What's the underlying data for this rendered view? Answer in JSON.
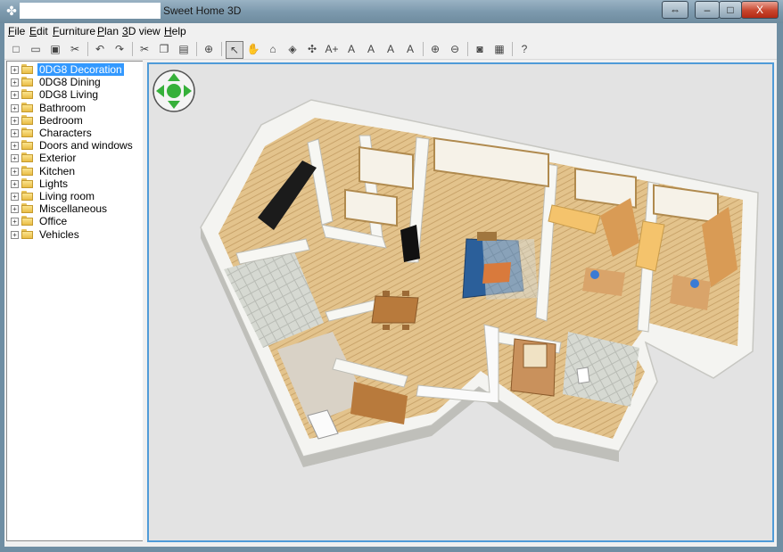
{
  "window": {
    "title": "Sweet Home 3D",
    "icon": "app-icon",
    "controls": {
      "swap": "⇔",
      "minimize": "–",
      "maximize": "□",
      "close": "X"
    }
  },
  "menu": [
    "File",
    "Edit",
    "Furniture",
    "Plan",
    "3D view",
    "Help"
  ],
  "toolbar": [
    {
      "name": "new-home-icon",
      "glyph": "□"
    },
    {
      "name": "open-icon",
      "glyph": "▭"
    },
    {
      "name": "save-icon",
      "glyph": "▣"
    },
    {
      "name": "preferences-icon",
      "glyph": "✂"
    },
    {
      "name": "undo-icon",
      "glyph": "↶"
    },
    {
      "name": "redo-icon",
      "glyph": "↷"
    },
    {
      "name": "cut-icon",
      "glyph": "✂"
    },
    {
      "name": "copy-icon",
      "glyph": "❐"
    },
    {
      "name": "paste-icon",
      "glyph": "▤"
    },
    {
      "name": "add-furniture-icon",
      "glyph": "⊕"
    },
    {
      "name": "select-mode-icon",
      "glyph": "↖",
      "selected": true
    },
    {
      "name": "pan-mode-icon",
      "glyph": "✋"
    },
    {
      "name": "create-walls-icon",
      "glyph": "⌂"
    },
    {
      "name": "create-rooms-icon",
      "glyph": "◈"
    },
    {
      "name": "create-dimensions-icon",
      "glyph": "✣"
    },
    {
      "name": "add-text-icon",
      "glyph": "A+"
    },
    {
      "name": "increase-text-size-icon",
      "glyph": "A"
    },
    {
      "name": "decrease-text-size-icon",
      "glyph": "A"
    },
    {
      "name": "bold-text-icon",
      "glyph": "A"
    },
    {
      "name": "italic-text-icon",
      "glyph": "A"
    },
    {
      "name": "zoom-in-icon",
      "glyph": "⊕"
    },
    {
      "name": "zoom-out-icon",
      "glyph": "⊖"
    },
    {
      "name": "create-photo-icon",
      "glyph": "◙"
    },
    {
      "name": "create-video-icon",
      "glyph": "▦"
    },
    {
      "name": "help-icon",
      "glyph": "?"
    }
  ],
  "catalog": [
    {
      "label": "0DG8 Decoration",
      "selected": true
    },
    {
      "label": "0DG8 Dining"
    },
    {
      "label": "0DG8 Living"
    },
    {
      "label": "Bathroom"
    },
    {
      "label": "Bedroom"
    },
    {
      "label": "Characters"
    },
    {
      "label": "Doors and windows"
    },
    {
      "label": "Exterior"
    },
    {
      "label": "Kitchen"
    },
    {
      "label": "Lights"
    },
    {
      "label": "Living room"
    },
    {
      "label": "Miscellaneous"
    },
    {
      "label": "Office"
    },
    {
      "label": "Vehicles"
    }
  ],
  "colors": {
    "accent": "#3399ff",
    "view_border": "#4f9bd8",
    "nav_arrows": "#36b03a"
  }
}
